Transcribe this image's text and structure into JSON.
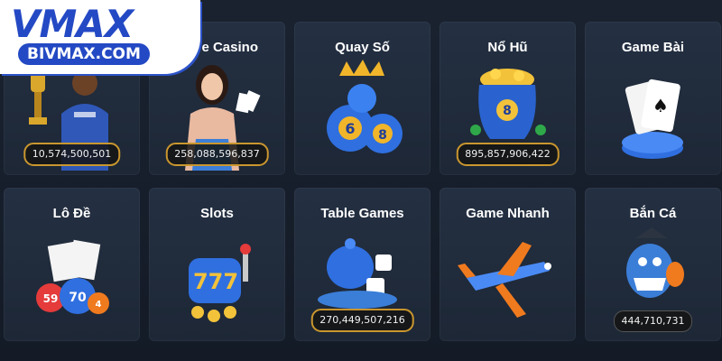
{
  "logo": {
    "brand": "VMAX",
    "domain": "BIVMAX.COM"
  },
  "games": [
    {
      "title": "",
      "jackpot": "10,574,500,501"
    },
    {
      "title": "ve Casino",
      "jackpot": "258,088,596,837"
    },
    {
      "title": "Quay Số",
      "jackpot": ""
    },
    {
      "title": "Nổ Hũ",
      "jackpot": "895,857,906,422"
    },
    {
      "title": "Game Bài",
      "jackpot": ""
    },
    {
      "title": "Lô Đề",
      "jackpot": ""
    },
    {
      "title": "Slots",
      "jackpot": ""
    },
    {
      "title": "Table Games",
      "jackpot": "270,449,507,216"
    },
    {
      "title": "Game Nhanh",
      "jackpot": ""
    },
    {
      "title": "Bắn Cá",
      "jackpot": "444,710,731"
    }
  ],
  "icons": [
    "trophy-player-icon",
    "casino-dealer-icon",
    "lottery-balls-icon",
    "pot-of-gold-icon",
    "playing-cards-icon",
    "bingo-balls-icon",
    "slot-machine-icon",
    "dice-cup-icon",
    "airplane-icon",
    "fish-shark-icon"
  ],
  "colors": {
    "background": "#141b27",
    "card": "#222d3e",
    "brand_blue": "#2449c4",
    "jackpot_border": "#c9962e"
  }
}
